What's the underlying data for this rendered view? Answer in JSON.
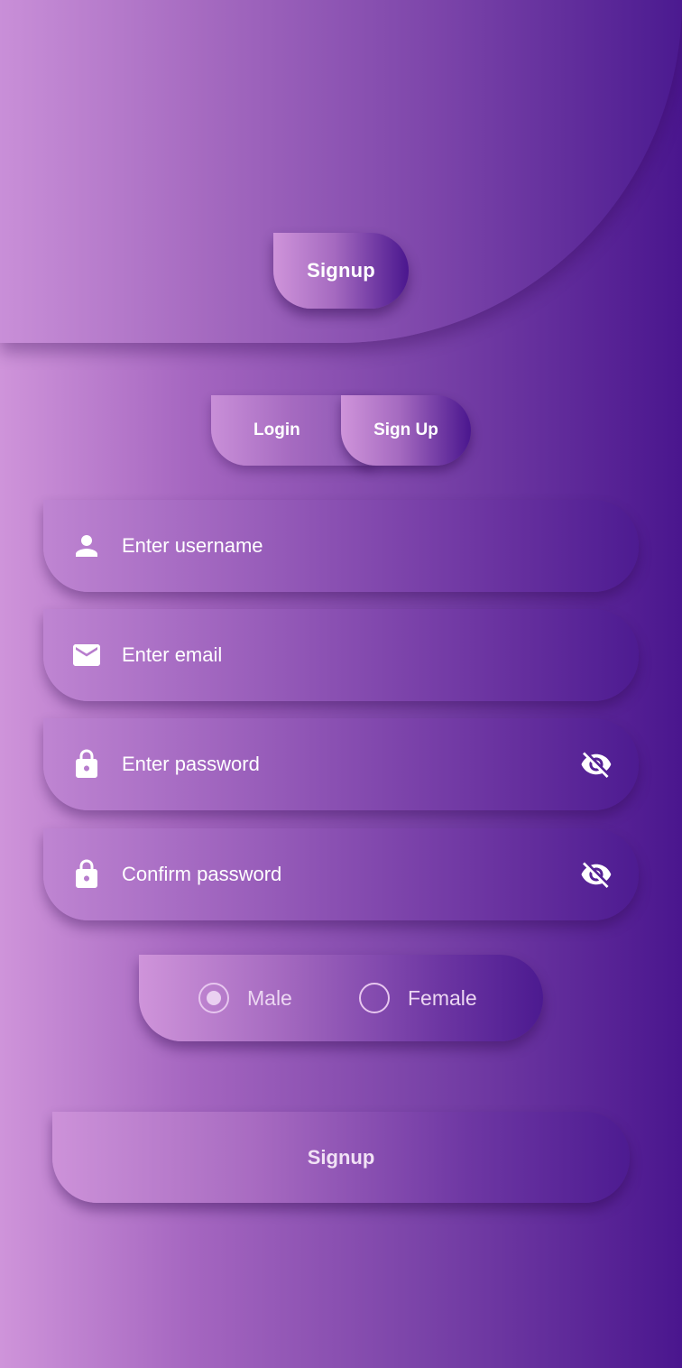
{
  "header": {
    "title_button": "Signup"
  },
  "tabs": {
    "login": "Login",
    "signup": "Sign Up",
    "active": "signup"
  },
  "form": {
    "username": {
      "placeholder": "Enter username",
      "icon": "person-icon"
    },
    "email": {
      "placeholder": "Enter email",
      "icon": "mail-icon"
    },
    "password": {
      "placeholder": "Enter password",
      "icon": "lock-icon",
      "toggle_icon": "eye-off-icon"
    },
    "confirm_password": {
      "placeholder": "Confirm password",
      "icon": "lock-icon",
      "toggle_icon": "eye-off-icon"
    }
  },
  "gender": {
    "options": [
      "Male",
      "Female"
    ],
    "selected": "Male"
  },
  "submit": {
    "label": "Signup"
  },
  "colors": {
    "gradient_start": "#cf94da",
    "gradient_end": "#4a168e",
    "text": "#ffffff"
  }
}
